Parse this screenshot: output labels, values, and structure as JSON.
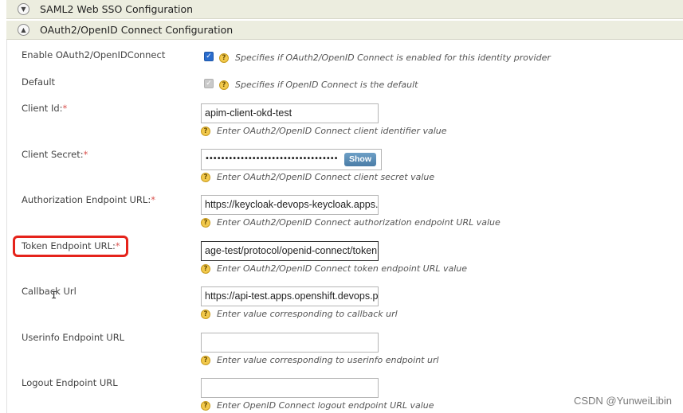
{
  "sections": {
    "saml": {
      "title": "SAML2 Web SSO Configuration",
      "toggle_icon": "chevron-down-icon"
    },
    "oauth": {
      "title": "OAuth2/OpenID Connect Configuration",
      "toggle_icon": "chevron-up-icon"
    }
  },
  "fields": {
    "enable": {
      "label": "Enable OAuth2/OpenIDConnect",
      "checked": true,
      "hint": "Specifies if OAuth2/OpenID Connect is enabled for this identity provider"
    },
    "default": {
      "label": "Default",
      "checked": true,
      "disabled": true,
      "hint": "Specifies if OpenID Connect is the default"
    },
    "client_id": {
      "label": "Client Id:",
      "required": "*",
      "value": "apim-client-okd-test",
      "hint": "Enter OAuth2/OpenID Connect client identifier value"
    },
    "client_secret": {
      "label": "Client Secret:",
      "required": "*",
      "masked_value": "••••••••••••••••••••••••••••••••••",
      "show_label": "Show",
      "hint": "Enter OAuth2/OpenID Connect client secret value"
    },
    "authz_endpoint": {
      "label": "Authorization Endpoint URL:",
      "required": "*",
      "value": "https://keycloak-devops-keycloak.apps.",
      "hint": "Enter OAuth2/OpenID Connect authorization endpoint URL value"
    },
    "token_endpoint": {
      "label": "Token Endpoint URL:",
      "required": "*",
      "value": "age-test/protocol/openid-connect/token",
      "hint": "Enter OAuth2/OpenID Connect token endpoint URL value"
    },
    "callback": {
      "label": "Callback Url",
      "value": "https://api-test.apps.openshift.devops.p",
      "hint": "Enter value corresponding to callback url"
    },
    "userinfo": {
      "label": "Userinfo Endpoint URL",
      "value": "",
      "hint": "Enter value corresponding to userinfo endpoint url"
    },
    "logout": {
      "label": "Logout Endpoint URL",
      "value": "",
      "hint": "Enter OpenID Connect logout endpoint URL value"
    }
  },
  "icons": {
    "help": "help-icon",
    "cursor": "text-cursor-icon"
  },
  "colors": {
    "header_bg": "#eceddf",
    "required": "#d9534f",
    "highlight": "#e5231b",
    "checkbox": "#2a6ccd"
  },
  "watermark": "CSDN @YunweiLibin"
}
